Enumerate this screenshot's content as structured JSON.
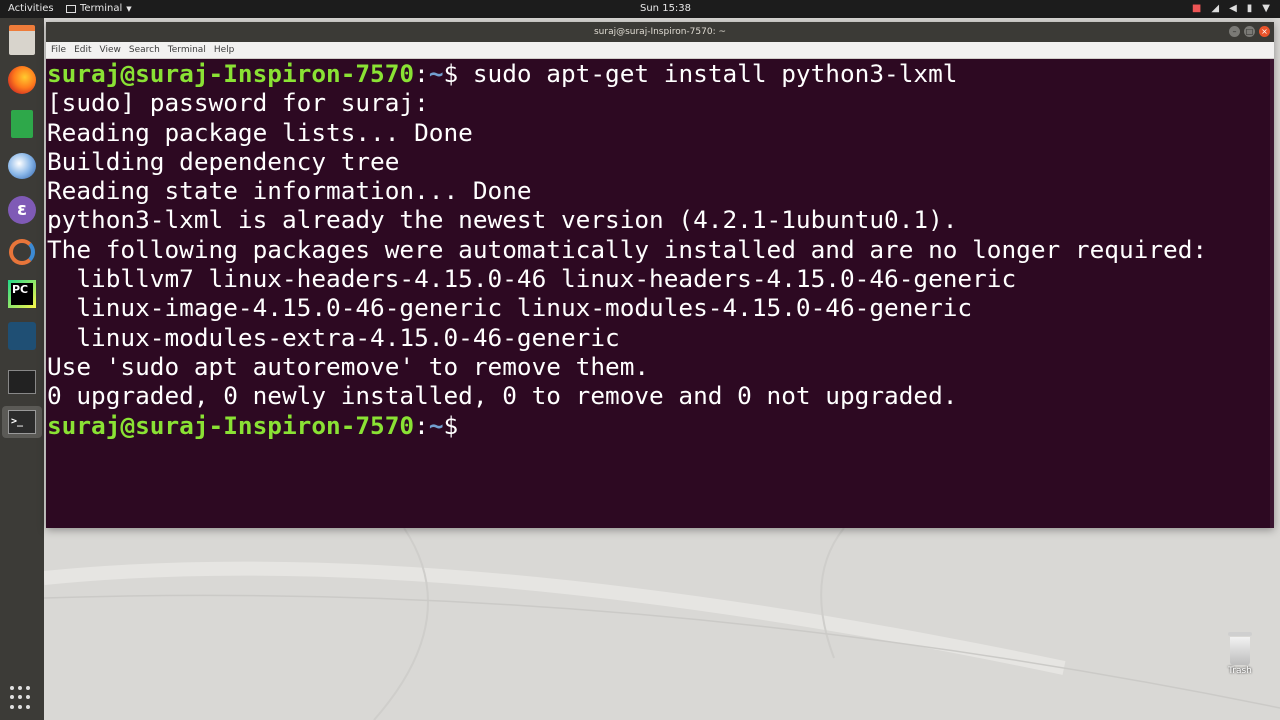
{
  "topbar": {
    "activities": "Activities",
    "app_menu": "Terminal",
    "clock": "Sun 15:38",
    "tray_icons": [
      "camera-icon",
      "network-icon",
      "volume-icon",
      "battery-icon",
      "chevron-down-icon"
    ]
  },
  "dock": {
    "items": [
      "files-icon",
      "firefox-icon",
      "calc-icon",
      "thunderbird-icon",
      "emacs-icon",
      "git-icon",
      "pycharm-icon",
      "mysql-workbench-icon",
      "system-monitor-icon",
      "terminal-icon"
    ],
    "pycharm_label": "PC"
  },
  "window": {
    "title": "suraj@suraj-Inspiron-7570: ~",
    "menu": [
      "File",
      "Edit",
      "View",
      "Search",
      "Terminal",
      "Help"
    ]
  },
  "terminal": {
    "prompt_user": "suraj@suraj-Inspiron-7570",
    "prompt_sep": ":",
    "prompt_path": "~",
    "command": "$ sudo apt-get install python3-lxml",
    "output": [
      "[sudo] password for suraj:",
      "Reading package lists... Done",
      "Building dependency tree",
      "Reading state information... Done",
      "python3-lxml is already the newest version (4.2.1-1ubuntu0.1).",
      "The following packages were automatically installed and are no longer required:",
      "  libllvm7 linux-headers-4.15.0-46 linux-headers-4.15.0-46-generic",
      "  linux-image-4.15.0-46-generic linux-modules-4.15.0-46-generic",
      "  linux-modules-extra-4.15.0-46-generic",
      "Use 'sudo apt autoremove' to remove them.",
      "0 upgraded, 0 newly installed, 0 to remove and 0 not upgraded."
    ],
    "prompt_end": "$",
    "colors": {
      "background": "#2d0922",
      "prompt_user": "#8ae234",
      "prompt_path": "#729fcf",
      "text": "#ffffff"
    }
  },
  "desktop": {
    "trash_label": "Trash"
  }
}
